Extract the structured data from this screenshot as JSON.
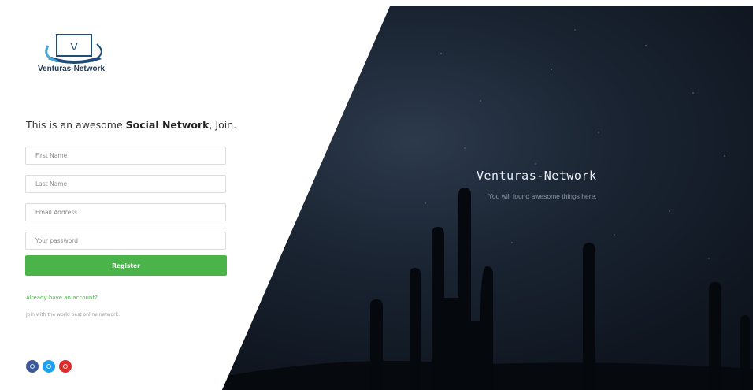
{
  "brand": {
    "name": "Venturas-Network",
    "logo_letter": "V"
  },
  "tagline": {
    "prefix": "This is an awesome ",
    "bold": "Social Network",
    "suffix": ", Join."
  },
  "form": {
    "first_name_placeholder": "First Name",
    "last_name_placeholder": "Last Name",
    "email_placeholder": "Email Address",
    "password_placeholder": "Your password",
    "register_label": "Register"
  },
  "links": {
    "have_account": "Already have an account?"
  },
  "join_text": "Join with the world best online network.",
  "hero": {
    "title": "Venturas-Network",
    "subtitle": "You will found awesome things here."
  },
  "social": [
    {
      "icon": "facebook-icon",
      "color": "#3b5998"
    },
    {
      "icon": "twitter-icon",
      "color": "#1da1f2"
    },
    {
      "icon": "google-plus-icon",
      "color": "#dd2c2c"
    }
  ],
  "colors": {
    "accent": "#4ab44b",
    "logo_blue": "#1f3a5a"
  }
}
